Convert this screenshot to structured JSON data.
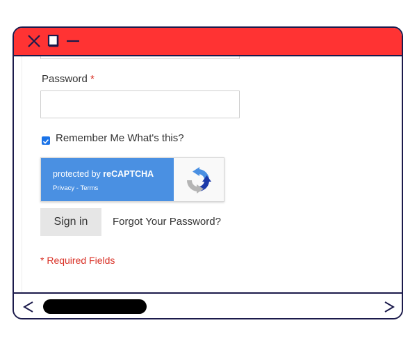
{
  "window": {
    "titlebar_color": "#ff3333",
    "frame_color": "#1b1a4b",
    "controls": {
      "close_icon": "close-icon",
      "maximize_icon": "maximize-icon",
      "minimize_icon": "minimize-icon"
    }
  },
  "form": {
    "password_label": "Password",
    "required_marker": "*",
    "password_value": "",
    "remember_checked": true,
    "remember_label": "Remember Me",
    "whats_this": "What's this?",
    "sign_in_label": "Sign in",
    "forgot_password_label": "Forgot Your Password?",
    "required_note": "* Required Fields"
  },
  "recaptcha": {
    "prefix": "protected by",
    "brand": "reCAPTCHA",
    "privacy": "Privacy",
    "separator": " - ",
    "terms": "Terms",
    "accent": "#4a90e2"
  },
  "scrollbar": {
    "left_icon": "chevron-left-icon",
    "right_icon": "chevron-right-icon"
  }
}
